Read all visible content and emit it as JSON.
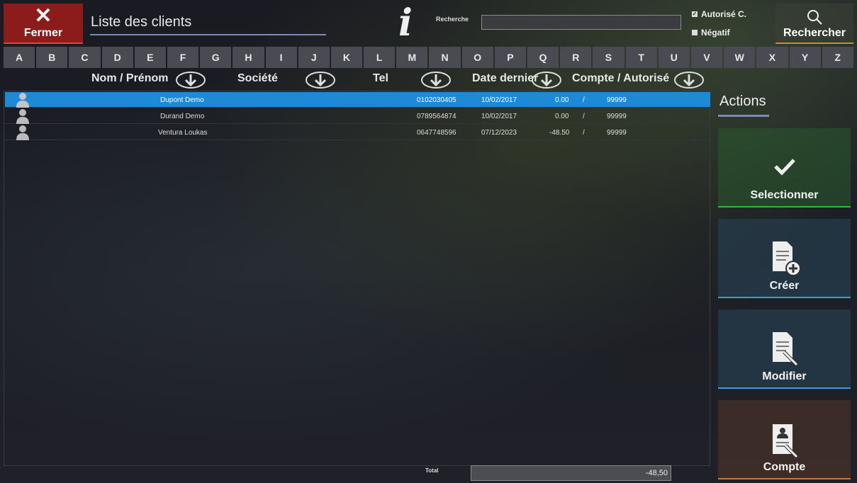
{
  "header": {
    "close_label": "Fermer",
    "title": "Liste des clients",
    "search_label": "Recherche",
    "search_value": "",
    "checkbox_autorise": "Autorisé C.",
    "checkbox_negatif": "Négatif",
    "search_button": "Rechercher"
  },
  "alphabet": [
    "A",
    "B",
    "C",
    "D",
    "E",
    "F",
    "G",
    "H",
    "I",
    "J",
    "K",
    "L",
    "M",
    "N",
    "O",
    "P",
    "Q",
    "R",
    "S",
    "T",
    "U",
    "V",
    "W",
    "X",
    "Y",
    "Z"
  ],
  "columns": {
    "name": "Nom / Prénom",
    "company": "Société",
    "tel": "Tel",
    "date": "Date dernier",
    "account": "Compte / Autorisé"
  },
  "rows": [
    {
      "name": "Dupont Demo",
      "tel": "0102030405",
      "date": "10/02/2017",
      "balance": "0.00",
      "sep": "/",
      "authorized": "99999",
      "selected": true
    },
    {
      "name": "Durand Demo",
      "tel": "0789564874",
      "date": "10/02/2017",
      "balance": "0.00",
      "sep": "/",
      "authorized": "99999",
      "selected": false
    },
    {
      "name": "Ventura Loukas",
      "tel": "0647748596",
      "date": "07/12/2023",
      "balance": "-48.50",
      "sep": "/",
      "authorized": "99999",
      "selected": false
    }
  ],
  "footer": {
    "total_label": "Total",
    "total_value": "-48,50"
  },
  "actions": {
    "title": "Actions",
    "select": "Selectionner",
    "create": "Créer",
    "modify": "Modifier",
    "account": "Compte"
  },
  "colors": {
    "selected_row": "#1e8ad6",
    "close": "#8c1c1c",
    "select_accent": "#2dba3a",
    "create_accent": "#38a0d8",
    "account_accent": "#c8783a"
  }
}
